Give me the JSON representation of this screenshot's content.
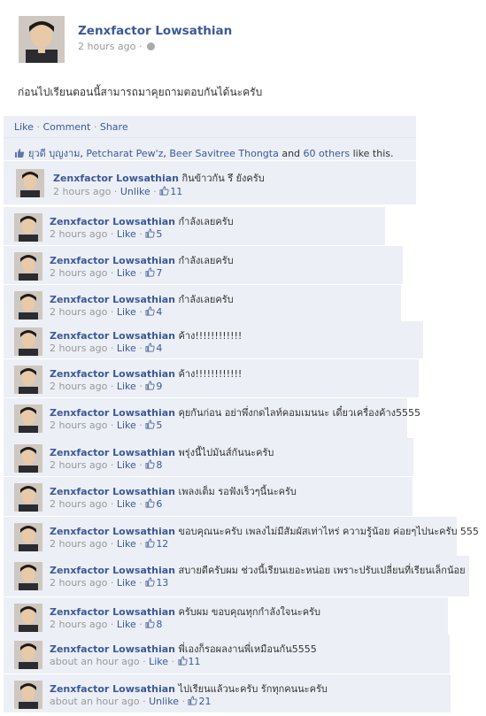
{
  "post": {
    "author": "Zenxfactor Lowsathian",
    "time": "2 hours ago",
    "separator": "·",
    "text": "ก่อนไปเรียนตอนนี้สามารถมาคุยถามตอบกันได้นะครับ"
  },
  "actions": {
    "like": "Like",
    "comment": "Comment",
    "share": "Share",
    "separator": "·"
  },
  "likes": {
    "name1": "ยุวดี บุญงาม",
    "name2": "Petcharat Pew'z",
    "name3": "Beer Savitree Thongta",
    "and": "and",
    "others": "60 others",
    "suffix": "like this.",
    "comma": ","
  },
  "comments": [
    {
      "author": "Zenxfactor Lowsathian",
      "text": "กินข้าวกัน รึ ยังครับ",
      "time": "2 hours ago",
      "action": "Unlike",
      "likes": "11"
    },
    {
      "author": "Zenxfactor Lowsathian",
      "text": "กำลังเลยครับ",
      "time": "2 hours ago",
      "action": "Like",
      "likes": "5"
    },
    {
      "author": "Zenxfactor Lowsathian",
      "text": "กำลังเลยครับ",
      "time": "2 hours ago",
      "action": "Like",
      "likes": "7"
    },
    {
      "author": "Zenxfactor Lowsathian",
      "text": "กำลังเลยครับ",
      "time": "2 hours ago",
      "action": "Like",
      "likes": "4"
    },
    {
      "author": "Zenxfactor Lowsathian",
      "text": "ค้าง!!!!!!!!!!!!",
      "time": "2 hours ago",
      "action": "Like",
      "likes": "4"
    },
    {
      "author": "Zenxfactor Lowsathian",
      "text": "ค้าง!!!!!!!!!!!!",
      "time": "2 hours ago",
      "action": "Like",
      "likes": "9"
    },
    {
      "author": "Zenxfactor Lowsathian",
      "text": "คุยกันก่อน อย่าพึ่งกดไลท์คอมเมนนะ เดี๋ยวเครื่องค้าง5555",
      "time": "2 hours ago",
      "action": "Like",
      "likes": "5"
    },
    {
      "author": "Zenxfactor Lowsathian",
      "text": "พรุ่งนี้ไปมันส์กันนะครับ",
      "time": "2 hours ago",
      "action": "Like",
      "likes": "8"
    },
    {
      "author": "Zenxfactor Lowsathian",
      "text": "เพลงเต็ม รอฟังเร็วๆนี้นะครับ",
      "time": "2 hours ago",
      "action": "Like",
      "likes": "6"
    },
    {
      "author": "Zenxfactor Lowsathian",
      "text": "ขอบคุณนะครับ เพลงไม่มีสัมผัสเท่าไหร่ ความรู้น้อย ค่อยๆไปนะครับ 555",
      "time": "2 hours ago",
      "action": "Like",
      "likes": "12"
    },
    {
      "author": "Zenxfactor Lowsathian",
      "text": "สบายดีครับผม ช่วงนี้เรียนเยอะหน่อย เพราะปรับเปลี่ยนที่เรียนเล็กน้อย",
      "time": "2 hours ago",
      "action": "Like",
      "likes": "13"
    },
    {
      "author": "Zenxfactor Lowsathian",
      "text": "ครับผม ขอบคุณทุกกำลังใจนะครับ",
      "time": "2 hours ago",
      "action": "Like",
      "likes": "8"
    },
    {
      "author": "Zenxfactor Lowsathian",
      "text": "พี่เองก็รอผลงานพี่เหมือนกัน5555",
      "time": "about an hour ago",
      "action": "Like",
      "likes": "11"
    },
    {
      "author": "Zenxfactor Lowsathian",
      "text": "ไปเรียนแล้วนะครับ รักทุกคนนะครับ",
      "time": "about an hour ago",
      "action": "Unlike",
      "likes": "21"
    }
  ],
  "colors": {
    "link": "#3b5998",
    "comment_bg": "#eceff5",
    "meta": "#999999"
  }
}
